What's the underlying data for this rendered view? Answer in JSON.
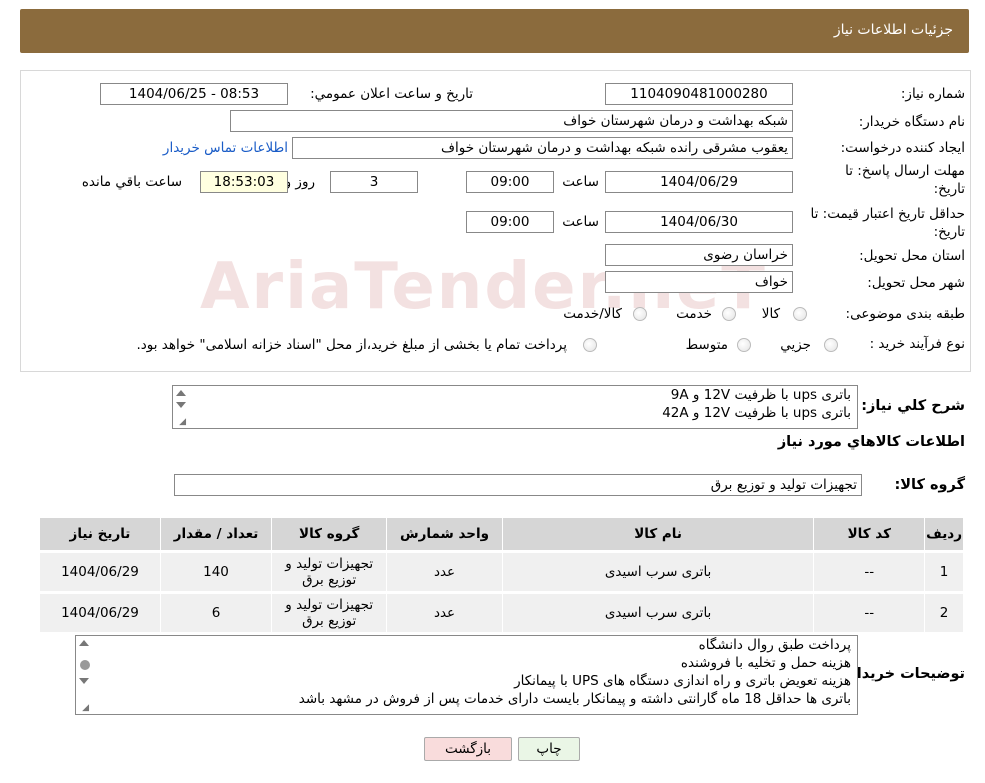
{
  "header": {
    "title": "جزئیات اطلاعات نیاز"
  },
  "fields": {
    "need_number_label": "شماره نیاز:",
    "need_number": "1104090481000280",
    "announce_label": "تاریخ و ساعت اعلان عمومي:",
    "announce_value": "1404/06/25 - 08:53",
    "buyer_org_label": "نام دستگاه خريدار:",
    "buyer_org": "شبکه بهداشت و درمان شهرستان خواف",
    "requester_label": "ایجاد کننده درخواست:",
    "requester": "يعقوب مشرقی رانده شبکه بهداشت و درمان شهرستان خواف",
    "contact_link": "اطلاعات تماس خریدار",
    "deadline_label_1": "مهلت ارسال پاسخ: تا",
    "deadline_label_2": "تاريخ:",
    "deadline_date": "1404/06/29",
    "time_label": "ساعت",
    "deadline_time": "09:00",
    "days": "3",
    "days_label": "روز و",
    "remaining": "18:53:03",
    "remaining_label": "ساعت باقي مانده",
    "validity_label_1": "حداقل تاريخ اعتبار قيمت: تا",
    "validity_label_2": "تاريخ:",
    "validity_date": "1404/06/30",
    "validity_time": "09:00",
    "province_label": "استان محل تحويل:",
    "province": "خراسان رضوی",
    "city_label": "شهر محل تحويل:",
    "city": "خواف",
    "category_label": "طبقه بندی موضوعی:",
    "category_options": [
      "کالا",
      "خدمت",
      "کالا/خدمت"
    ],
    "process_label": "نوع فرآيند خريد :",
    "process_options": [
      "جزيي",
      "متوسط"
    ],
    "process_note": "پرداخت تمام يا بخشی از مبلغ خريد،از محل \"اسناد خزانه اسلامی\" خواهد بود."
  },
  "description": {
    "label": "شرح کلي نياز:",
    "lines": [
      "باتری ups با ظرفیت 12V و 9A",
      "باتری ups با ظرفیت 12V و 42A"
    ]
  },
  "goods_section": {
    "title": "اطلاعات کالاهاي مورد نياز",
    "group_label": "گروه کالا:",
    "group_value": "تجهیزات تولید و توزیع برق"
  },
  "table": {
    "headers": [
      "رديف",
      "کد کالا",
      "نام کالا",
      "واحد شمارش",
      "گروه کالا",
      "تعداد / مقدار",
      "تاریخ نیاز"
    ],
    "rows": [
      [
        "1",
        "--",
        "باتری سرب اسیدی",
        "عدد",
        "تجهیزات تولید و توزیع برق",
        "140",
        "1404/06/29"
      ],
      [
        "2",
        "--",
        "باتری سرب اسیدی",
        "عدد",
        "تجهیزات تولید و توزیع برق",
        "6",
        "1404/06/29"
      ]
    ]
  },
  "buyer_notes": {
    "label": "توضیحات خریدار:",
    "lines": [
      "پرداخت طبق روال دانشگاه",
      "هزینه حمل و تخلیه با فروشنده",
      "هزینه تعویض باتری و راه اندازی دستگاه های UPS با پیمانکار",
      "باتری ها حداقل 18 ماه گارانتی داشته و پیمانکار بایست دارای خدمات پس از فروش در مشهد باشد"
    ]
  },
  "buttons": {
    "print": "چاپ",
    "back": "بازگشت"
  },
  "watermark": "AriaTender.neT",
  "colors": {
    "header_bg": "#8B6B3D",
    "link": "#1a5cc7",
    "back_button_bg": "#f9dcdc",
    "print_button_bg": "#eaf6e6"
  }
}
